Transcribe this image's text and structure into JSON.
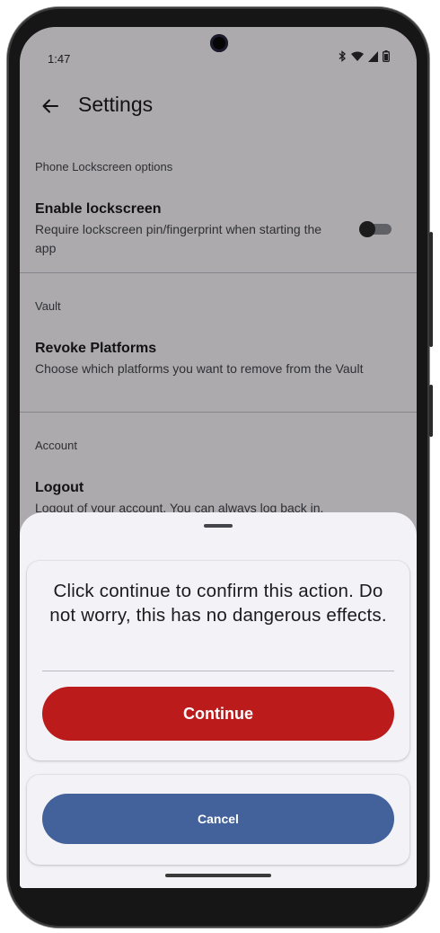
{
  "status_bar": {
    "time": "1:47",
    "icons": [
      "bluetooth-icon",
      "wifi-icon",
      "signal-icon",
      "battery-icon"
    ]
  },
  "app_bar": {
    "title": "Settings"
  },
  "settings": {
    "sections": [
      {
        "header": "Phone Lockscreen options",
        "items": [
          {
            "title": "Enable lockscreen",
            "summary": "Require lockscreen pin/fingerprint when starting the app",
            "toggle_on": false
          }
        ]
      },
      {
        "header": "Vault",
        "items": [
          {
            "title": "Revoke Platforms",
            "summary": "Choose which platforms you want to remove from the Vault"
          }
        ]
      },
      {
        "header": "Account",
        "items": [
          {
            "title": "Logout",
            "summary": "Logout of your account. You can always log back in."
          }
        ]
      }
    ]
  },
  "bottom_sheet": {
    "message": "Click continue to confirm this action. Do not worry, this has no dangerous effects.",
    "continue_label": "Continue",
    "cancel_label": "Cancel"
  },
  "colors": {
    "continue_button": "#bb1b1b",
    "cancel_button": "#43619a",
    "sheet_background": "#f3f3f7"
  }
}
